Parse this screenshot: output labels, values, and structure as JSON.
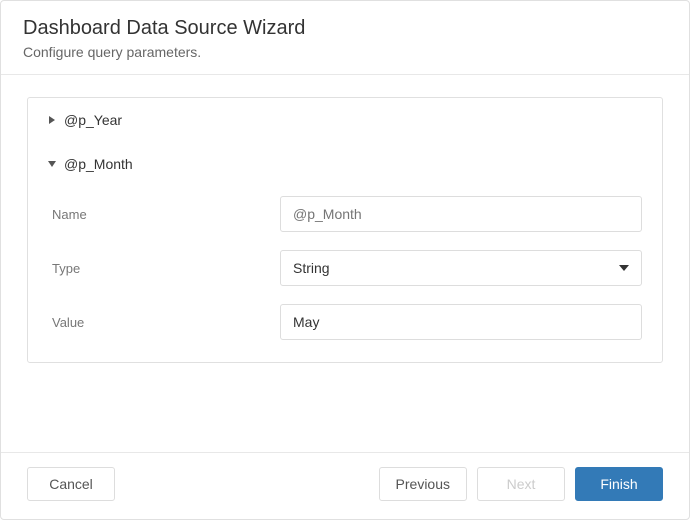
{
  "header": {
    "title": "Dashboard Data Source Wizard",
    "subtitle": "Configure query parameters."
  },
  "parameters": {
    "collapsed": {
      "label": "@p_Year"
    },
    "expanded": {
      "label": "@p_Month",
      "fields": {
        "name": {
          "label": "Name",
          "placeholder": "@p_Month",
          "value": ""
        },
        "type": {
          "label": "Type",
          "value": "String"
        },
        "value": {
          "label": "Value",
          "value": "May"
        }
      }
    }
  },
  "footer": {
    "cancel": "Cancel",
    "previous": "Previous",
    "next": "Next",
    "finish": "Finish"
  },
  "colors": {
    "primary": "#337ab7",
    "border": "#e0e0e0",
    "textMuted": "#777"
  }
}
